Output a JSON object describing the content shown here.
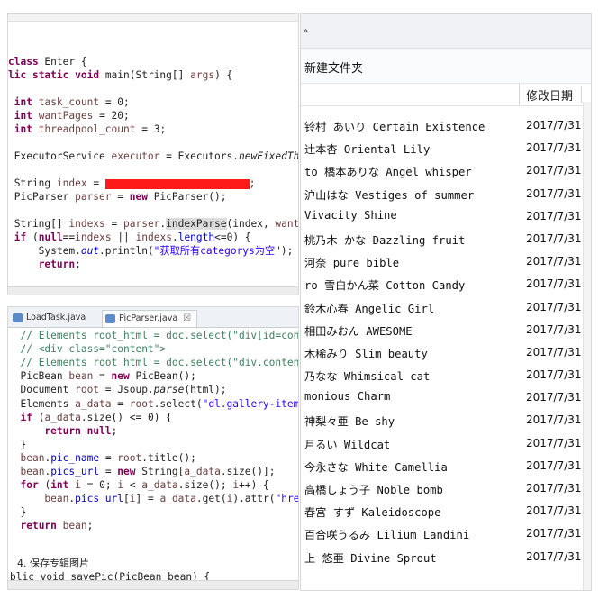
{
  "code_top": {
    "lines": [
      {
        "segs": [
          {
            "t": "class",
            "c": "kw"
          },
          {
            "t": " Enter {"
          }
        ]
      },
      {
        "segs": [
          {
            "t": "lic ",
            "c": "kw"
          },
          {
            "t": "static",
            "c": "kw"
          },
          {
            "t": " "
          },
          {
            "t": "void",
            "c": "kw"
          },
          {
            "t": " main(String[] "
          },
          {
            "t": "args",
            "c": "var"
          },
          {
            "t": ") {"
          }
        ]
      },
      {
        "segs": [
          {
            "t": ""
          }
        ]
      },
      {
        "segs": [
          {
            "t": " "
          },
          {
            "t": "int",
            "c": "kw"
          },
          {
            "t": " "
          },
          {
            "t": "task_count",
            "c": "var"
          },
          {
            "t": " = 0;"
          }
        ]
      },
      {
        "segs": [
          {
            "t": " "
          },
          {
            "t": "int",
            "c": "kw"
          },
          {
            "t": " "
          },
          {
            "t": "wantPages",
            "c": "var"
          },
          {
            "t": " = 20;"
          }
        ]
      },
      {
        "segs": [
          {
            "t": " "
          },
          {
            "t": "int",
            "c": "kw"
          },
          {
            "t": " "
          },
          {
            "t": "threadpool_count",
            "c": "var"
          },
          {
            "t": " = 3;"
          }
        ]
      },
      {
        "segs": [
          {
            "t": ""
          }
        ]
      },
      {
        "segs": [
          {
            "t": " ExecutorService "
          },
          {
            "t": "executor",
            "c": "var"
          },
          {
            "t": " = Executors."
          },
          {
            "t": "newFixedTh",
            "c": "ital"
          }
        ]
      },
      {
        "segs": [
          {
            "t": ""
          }
        ]
      },
      {
        "segs": [
          {
            "t": " String "
          },
          {
            "t": "index",
            "c": "var"
          },
          {
            "t": " = "
          },
          {
            "t": "",
            "c": "redact"
          },
          {
            "t": ";"
          }
        ]
      },
      {
        "segs": [
          {
            "t": " PicParser "
          },
          {
            "t": "parser",
            "c": "var"
          },
          {
            "t": " = "
          },
          {
            "t": "new",
            "c": "kw"
          },
          {
            "t": " PicParser();"
          }
        ]
      },
      {
        "segs": [
          {
            "t": ""
          }
        ],
        "row": "hlrow"
      },
      {
        "segs": [
          {
            "t": " String[] "
          },
          {
            "t": "indexs",
            "c": "var"
          },
          {
            "t": " = "
          },
          {
            "t": "parser",
            "c": "var"
          },
          {
            "t": "."
          },
          {
            "t": "indexParse",
            "c": "hl"
          },
          {
            "t": "(index, "
          },
          {
            "t": "want",
            "c": "var"
          }
        ]
      },
      {
        "segs": [
          {
            "t": " "
          },
          {
            "t": "if",
            "c": "kw"
          },
          {
            "t": " ("
          },
          {
            "t": "null",
            "c": "kw"
          },
          {
            "t": "=="
          },
          {
            "t": "indexs",
            "c": "var"
          },
          {
            "t": " || "
          },
          {
            "t": "indexs",
            "c": "var"
          },
          {
            "t": "."
          },
          {
            "t": "length",
            "c": "fld"
          },
          {
            "t": "<=0) {"
          }
        ]
      },
      {
        "segs": [
          {
            "t": "     System."
          },
          {
            "t": "out",
            "c": "fld ital"
          },
          {
            "t": ".println("
          },
          {
            "t": "\"获取所有categorys为空\"",
            "c": "str"
          },
          {
            "t": ");"
          }
        ]
      },
      {
        "segs": [
          {
            "t": "     "
          },
          {
            "t": "return",
            "c": "kw"
          },
          {
            "t": ";"
          }
        ]
      }
    ]
  },
  "code_bottom": {
    "tabs": [
      {
        "label": "LoadTask.java"
      },
      {
        "label": "PicParser.java"
      }
    ],
    "close_glyph": "☒",
    "lines": [
      {
        "segs": [
          {
            "t": "  "
          },
          {
            "t": "// Elements root_html = doc.select(\"div[id=con",
            "c": "cmt"
          }
        ]
      },
      {
        "segs": [
          {
            "t": "  "
          },
          {
            "t": "// <div class=\"content\">",
            "c": "cmt"
          }
        ]
      },
      {
        "segs": [
          {
            "t": "  "
          },
          {
            "t": "// Elements root_html = doc.select(\"div.conten",
            "c": "cmt"
          }
        ]
      },
      {
        "segs": [
          {
            "t": "  PicBean "
          },
          {
            "t": "bean",
            "c": "var"
          },
          {
            "t": " = "
          },
          {
            "t": "new",
            "c": "kw"
          },
          {
            "t": " PicBean();"
          }
        ]
      },
      {
        "segs": [
          {
            "t": "  Document "
          },
          {
            "t": "root",
            "c": "var"
          },
          {
            "t": " = Jsoup."
          },
          {
            "t": "parse",
            "c": "ital"
          },
          {
            "t": "(html);"
          }
        ]
      },
      {
        "segs": [
          {
            "t": "  Elements "
          },
          {
            "t": "a_data",
            "c": "var"
          },
          {
            "t": " = "
          },
          {
            "t": "root",
            "c": "var"
          },
          {
            "t": ".select("
          },
          {
            "t": "\"dl.gallery-item",
            "c": "str"
          }
        ]
      },
      {
        "segs": [
          {
            "t": "  "
          },
          {
            "t": "if",
            "c": "kw"
          },
          {
            "t": " ("
          },
          {
            "t": "a_data",
            "c": "var"
          },
          {
            "t": ".size() <= 0) {"
          }
        ]
      },
      {
        "segs": [
          {
            "t": "      "
          },
          {
            "t": "return",
            "c": "kw"
          },
          {
            "t": " "
          },
          {
            "t": "null",
            "c": "kw"
          },
          {
            "t": ";"
          }
        ]
      },
      {
        "segs": [
          {
            "t": "  }"
          }
        ]
      },
      {
        "segs": [
          {
            "t": "  "
          },
          {
            "t": "bean",
            "c": "var"
          },
          {
            "t": "."
          },
          {
            "t": "pic_name",
            "c": "fld"
          },
          {
            "t": " = "
          },
          {
            "t": "root",
            "c": "var"
          },
          {
            "t": ".title();"
          }
        ]
      },
      {
        "segs": [
          {
            "t": "  "
          },
          {
            "t": "bean",
            "c": "var"
          },
          {
            "t": "."
          },
          {
            "t": "pics_url",
            "c": "fld"
          },
          {
            "t": " = "
          },
          {
            "t": "new",
            "c": "kw"
          },
          {
            "t": " String["
          },
          {
            "t": "a_data",
            "c": "var"
          },
          {
            "t": ".size()];"
          }
        ]
      },
      {
        "segs": [
          {
            "t": "  "
          },
          {
            "t": "for",
            "c": "kw"
          },
          {
            "t": " ("
          },
          {
            "t": "int",
            "c": "kw"
          },
          {
            "t": " "
          },
          {
            "t": "i",
            "c": "var"
          },
          {
            "t": " = 0; "
          },
          {
            "t": "i",
            "c": "var"
          },
          {
            "t": " < "
          },
          {
            "t": "a_data",
            "c": "var"
          },
          {
            "t": ".size(); "
          },
          {
            "t": "i",
            "c": "var"
          },
          {
            "t": "++) {"
          }
        ]
      },
      {
        "segs": [
          {
            "t": "      "
          },
          {
            "t": "bean",
            "c": "var"
          },
          {
            "t": "."
          },
          {
            "t": "pics_url",
            "c": "fld"
          },
          {
            "t": "["
          },
          {
            "t": "i",
            "c": "var"
          },
          {
            "t": "] = "
          },
          {
            "t": "a_data",
            "c": "var"
          },
          {
            "t": ".get("
          },
          {
            "t": "i",
            "c": "var"
          },
          {
            "t": ").attr("
          },
          {
            "t": "\"hre",
            "c": "str"
          }
        ]
      },
      {
        "segs": [
          {
            "t": "  }"
          }
        ]
      },
      {
        "segs": [
          {
            "t": "  "
          },
          {
            "t": "return",
            "c": "kw"
          },
          {
            "t": " "
          },
          {
            "t": "bean",
            "c": "var"
          },
          {
            "t": ";"
          }
        ]
      }
    ],
    "step_label": "4. 保存专辑图片",
    "partial_last": "blic void savePic(PicBean bean) {"
  },
  "explorer": {
    "address_chevron": "»",
    "toolbar_new_folder": "新建文件夹",
    "header_date": "修改日期",
    "rows": [
      {
        "name": "铃村 あいり Certain Existence",
        "date": "2017/7/31"
      },
      {
        "name": "辻本杏 Oriental Lily",
        "date": "2017/7/31"
      },
      {
        "name": "to 橋本ありな Angel whisper",
        "date": "2017/7/31"
      },
      {
        "name": "沪山はな Vestiges of summer",
        "date": "2017/7/31"
      },
      {
        "name": " Vivacity Shine",
        "date": "2017/7/31"
      },
      {
        "name": " 桃乃木 かな Dazzling fruit",
        "date": "2017/7/31"
      },
      {
        "name": "河奈 pure bible",
        "date": "2017/7/31"
      },
      {
        "name": "ro 雪白かん菜 Cotton Candy",
        "date": "2017/7/31"
      },
      {
        "name": " 鈴木心春 Angelic Girl",
        "date": "2017/7/31"
      },
      {
        "name": "相田みおん AWESOME",
        "date": "2017/7/31"
      },
      {
        "name": "木稀みり Slim beauty",
        "date": "2017/7/31"
      },
      {
        "name": "乃なな Whimsical cat",
        "date": "2017/7/31"
      },
      {
        "name": "monious Charm",
        "date": "2017/7/31"
      },
      {
        "name": "神梨々亜 Be shy",
        "date": "2017/7/31"
      },
      {
        "name": "月るい Wildcat",
        "date": "2017/7/31"
      },
      {
        "name": "今永さな White Camellia",
        "date": "2017/7/31"
      },
      {
        "name": " 高橋しょう子 Noble bomb",
        "date": "2017/7/31"
      },
      {
        "name": " 春宮 すず Kaleidoscope",
        "date": "2017/7/31"
      },
      {
        "name": " 百合咲うるみ Lilium Landini",
        "date": "2017/7/31"
      },
      {
        "name": "上 悠亜 Divine Sprout",
        "date": "2017/7/31"
      }
    ]
  }
}
